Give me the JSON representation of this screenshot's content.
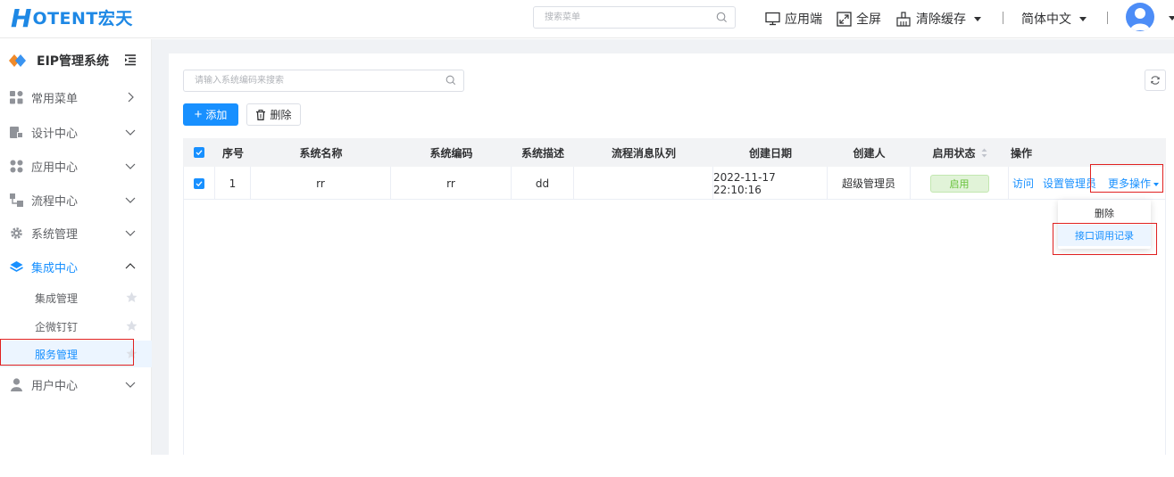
{
  "header": {
    "logo_h": "H",
    "logo_text": "OTENT宏天",
    "search_placeholder": "搜索菜单",
    "actions": {
      "app": "应用端",
      "fullscreen": "全屏",
      "clear_cache": "清除缓存",
      "language": "简体中文"
    }
  },
  "sidebar": {
    "system_title": "EIP管理系统",
    "items": [
      {
        "label": "常用菜单"
      },
      {
        "label": "设计中心"
      },
      {
        "label": "应用中心"
      },
      {
        "label": "流程中心"
      },
      {
        "label": "系统管理"
      },
      {
        "label": "集成中心"
      },
      {
        "label": "用户中心"
      }
    ],
    "subitems": [
      {
        "label": "集成管理"
      },
      {
        "label": "企微钉钉"
      },
      {
        "label": "服务管理"
      }
    ]
  },
  "toolbar": {
    "search_placeholder": "请输入系统编码来搜索",
    "add_label": "添加",
    "delete_label": "删除"
  },
  "table": {
    "columns": [
      "序号",
      "系统名称",
      "系统编码",
      "系统描述",
      "流程消息队列",
      "创建日期",
      "创建人",
      "启用状态",
      "操作"
    ],
    "rows": [
      {
        "index": "1",
        "name": "rr",
        "code": "rr",
        "desc": "dd",
        "queue": "",
        "created": "2022-11-17 22:10:16",
        "creator": "超级管理员",
        "status": "启用"
      }
    ],
    "ops": {
      "visit": "访问",
      "set_admin": "设置管理员",
      "more": "更多操作"
    }
  },
  "dropdown": {
    "items": [
      "删除",
      "接口调用记录"
    ]
  },
  "colors": {
    "primary": "#1890ff",
    "highlight": "#e02020",
    "success": "#67c23a"
  }
}
